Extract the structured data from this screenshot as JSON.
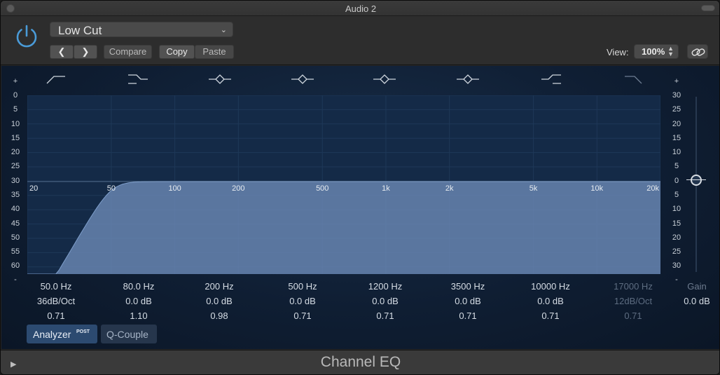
{
  "window": {
    "title": "Audio 2"
  },
  "header": {
    "preset": "Low Cut",
    "compare_label": "Compare",
    "copy_label": "Copy",
    "paste_label": "Paste",
    "view_label": "View:",
    "view_value": "100%"
  },
  "eq": {
    "db_scale_left": [
      "+",
      "0",
      "5",
      "10",
      "15",
      "20",
      "25",
      "30",
      "35",
      "40",
      "45",
      "50",
      "55",
      "60",
      "-"
    ],
    "db_scale_right": [
      "+",
      "30",
      "25",
      "20",
      "15",
      "10",
      "5",
      "0",
      "5",
      "10",
      "15",
      "20",
      "25",
      "30",
      "-"
    ],
    "freq_labels": [
      "20",
      "50",
      "100",
      "200",
      "500",
      "1k",
      "2k",
      "5k",
      "10k",
      "20k"
    ],
    "bands": [
      {
        "freq": "50.0 Hz",
        "gain": "36dB/Oct",
        "q": "0.71",
        "active": true,
        "icon": "low-cut-icon"
      },
      {
        "freq": "80.0 Hz",
        "gain": "0.0 dB",
        "q": "1.10",
        "active": true,
        "icon": "low-shelf-icon"
      },
      {
        "freq": "200 Hz",
        "gain": "0.0 dB",
        "q": "0.98",
        "active": true,
        "icon": "bell-icon"
      },
      {
        "freq": "500 Hz",
        "gain": "0.0 dB",
        "q": "0.71",
        "active": true,
        "icon": "bell-icon"
      },
      {
        "freq": "1200 Hz",
        "gain": "0.0 dB",
        "q": "0.71",
        "active": true,
        "icon": "bell-icon"
      },
      {
        "freq": "3500 Hz",
        "gain": "0.0 dB",
        "q": "0.71",
        "active": true,
        "icon": "bell-icon"
      },
      {
        "freq": "10000 Hz",
        "gain": "0.0 dB",
        "q": "0.71",
        "active": true,
        "icon": "high-shelf-icon"
      },
      {
        "freq": "17000 Hz",
        "gain": "12dB/Oct",
        "q": "0.71",
        "active": false,
        "icon": "high-cut-icon"
      }
    ],
    "master_gain_label": "Gain",
    "master_gain_value": "0.0 dB",
    "analyzer_label": "Analyzer",
    "analyzer_badge": "POST",
    "qcouple_label": "Q-Couple"
  },
  "footer": {
    "plugin_name": "Channel EQ"
  },
  "colors": {
    "accent": "#4a8fd0",
    "panel": "#142a47",
    "curve_fill": "#6d8bb8"
  }
}
